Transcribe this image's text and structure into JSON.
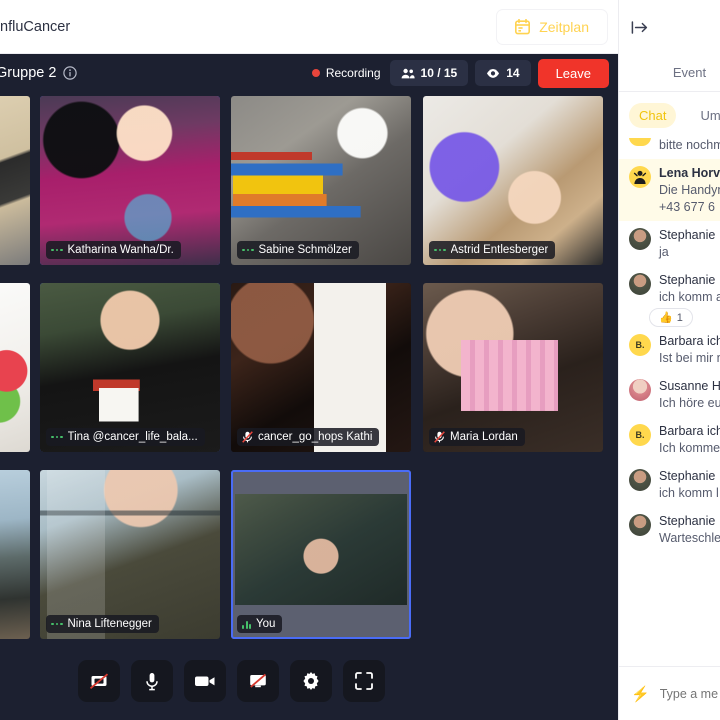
{
  "header": {
    "brand_title": "InfluCancer",
    "schedule_button": {
      "label": "Zeitplan",
      "icon": "calendar-icon"
    }
  },
  "meeting_bar": {
    "room_name": "Gruppe 2",
    "info_icon": "info-icon",
    "recording_label": "Recording",
    "participants_count": "10 / 15",
    "viewers_count": "14",
    "leave_label": "Leave"
  },
  "tiles": [
    {
      "name": "",
      "partial": true,
      "selected": false,
      "mic": "none",
      "pos": "r1c0"
    },
    {
      "name": "Katharina Wanha/Dr.",
      "partial": false,
      "selected": true,
      "mic": "dots",
      "pos": "r1c1"
    },
    {
      "name": "Sabine Schmölzer",
      "partial": false,
      "selected": false,
      "mic": "dots",
      "pos": "r1c2"
    },
    {
      "name": "Astrid Entlesberger",
      "partial": false,
      "selected": false,
      "mic": "dots",
      "pos": "r1c3"
    },
    {
      "name": "",
      "partial": true,
      "selected": false,
      "mic": "none",
      "pos": "r2c0"
    },
    {
      "name": "Tina @cancer_life_bala...",
      "partial": false,
      "selected": true,
      "mic": "dots",
      "pos": "r2c1"
    },
    {
      "name": "cancer_go_hops Kathi",
      "partial": false,
      "selected": false,
      "mic": "muted",
      "pos": "r2c2"
    },
    {
      "name": "Maria Lordan",
      "partial": false,
      "selected": false,
      "mic": "muted",
      "pos": "r2c3"
    },
    {
      "name": "",
      "partial": true,
      "selected": false,
      "mic": "none",
      "pos": "r3c0"
    },
    {
      "name": "Nina Liftenegger",
      "partial": false,
      "selected": false,
      "mic": "dots",
      "pos": "r3c1"
    },
    {
      "name": "You",
      "partial": false,
      "selected": true,
      "mic": "signal",
      "pos": "r3c2"
    }
  ],
  "controls": [
    {
      "icon": "screen-share-off-icon",
      "name": "screen-share-off-button"
    },
    {
      "icon": "microphone-icon",
      "name": "microphone-button"
    },
    {
      "icon": "camera-icon",
      "name": "camera-button"
    },
    {
      "icon": "present-off-icon",
      "name": "present-off-button"
    },
    {
      "icon": "gear-icon",
      "name": "settings-button"
    },
    {
      "icon": "fullscreen-icon",
      "name": "fullscreen-button"
    }
  ],
  "chat": {
    "collapse_icon": "collapse-panel-icon",
    "panel_tab": "Event",
    "subtabs": [
      {
        "label": "Chat",
        "active": true
      },
      {
        "label": "Umfrage",
        "active": false
      }
    ],
    "messages": [
      {
        "author": "",
        "text": "bitte nochm",
        "highlight": false,
        "avatar_type": "image-partial",
        "avatar_letter": "",
        "avatar_color": "#ffd351",
        "bold_name": false,
        "name_only": false
      },
      {
        "author": "Lena Horva",
        "text": "Die Handyn",
        "text2": "+43 677 6",
        "highlight": true,
        "avatar_type": "letter",
        "avatar_letter": "",
        "avatar_color": "#ffd84d",
        "bold_name": true
      },
      {
        "author": "Stephanie",
        "text": "ja",
        "highlight": false,
        "avatar_type": "image",
        "avatar_letter": "",
        "avatar_color": "#5b5f52",
        "bold_name": false
      },
      {
        "author": "Stephanie",
        "text": "ich komm a",
        "highlight": false,
        "avatar_type": "image",
        "avatar_letter": "",
        "avatar_color": "#5b5f52",
        "bold_name": false,
        "reaction": {
          "emoji": "👍",
          "count": "1"
        }
      },
      {
        "author": "Barbara ich",
        "text": "Ist bei mir n",
        "highlight": false,
        "avatar_type": "letter",
        "avatar_letter": "B.",
        "avatar_color": "#ffd84d",
        "bold_name": false
      },
      {
        "author": "Susanne H",
        "text": "Ich höre eu",
        "highlight": false,
        "avatar_type": "image",
        "avatar_letter": "",
        "avatar_color": "#d99a9a",
        "bold_name": false
      },
      {
        "author": "Barbara ich",
        "text": "Ich komme",
        "highlight": false,
        "avatar_type": "letter",
        "avatar_letter": "B.",
        "avatar_color": "#ffd84d",
        "bold_name": false
      },
      {
        "author": "Stephanie",
        "text": "ich komm l",
        "highlight": false,
        "avatar_type": "image",
        "avatar_letter": "",
        "avatar_color": "#5b5f52",
        "bold_name": false
      },
      {
        "author": "Stephanie",
        "text": "Warteschle",
        "highlight": false,
        "avatar_type": "image",
        "avatar_letter": "",
        "avatar_color": "#5b5f52",
        "bold_name": false
      }
    ],
    "input_placeholder": "Type a me",
    "bolt_icon": "lightning-icon"
  },
  "colors": {
    "dark_bg": "#1c2030",
    "accent_yellow": "#ffd351",
    "leave_red": "#f0342a",
    "selected_border": "#4a6cf7",
    "recording_red": "#e8453c"
  }
}
